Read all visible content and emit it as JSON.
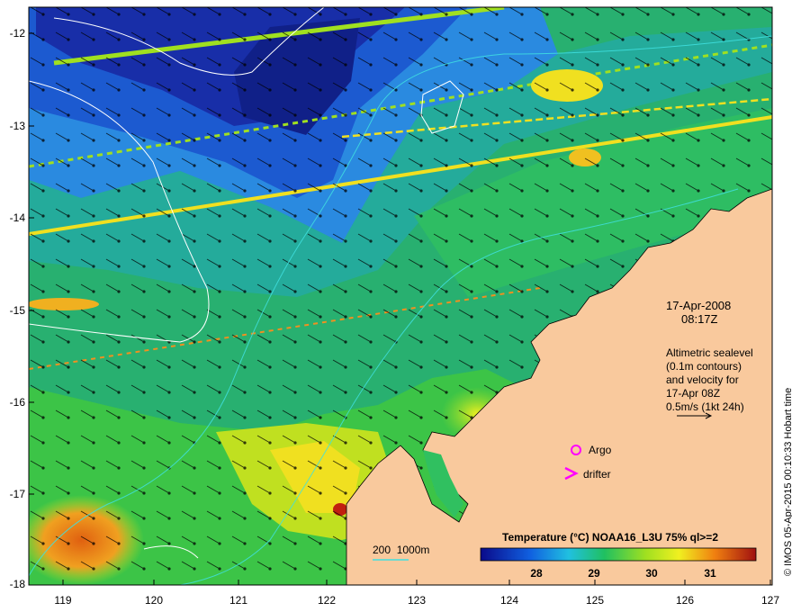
{
  "y_axis_labels": [
    "-12",
    "-13",
    "-14",
    "-15",
    "-16",
    "-17",
    "-18"
  ],
  "x_axis_labels": [
    "119",
    "120",
    "121",
    "122",
    "123",
    "124",
    "125",
    "126",
    "127"
  ],
  "timestamp": {
    "date": "17-Apr-2008",
    "time": "08:17Z"
  },
  "legend": {
    "lines": [
      "Altimetric sealevel",
      "(0.1m contours)",
      "and velocity for",
      "17-Apr 08Z",
      "0.5m/s (1kt 24h)"
    ]
  },
  "markers": {
    "argo": "Argo",
    "drifter": "drifter"
  },
  "bathymetry_label": "200  1000m",
  "colorbar": {
    "title": "Temperature (°C) NOAA16_L3U 75% ql>=2",
    "ticks": [
      "28",
      "29",
      "30",
      "31"
    ]
  },
  "credit": "© IMOS 05-Apr-2015 00:10:33 Hobart time",
  "colors": {
    "land": "#f9c99d",
    "cold": "#0a1a8a",
    "warm": "#d83010",
    "contour": "#ffffff",
    "bathy": "#40e0e0",
    "marker": "#ff00ff"
  }
}
